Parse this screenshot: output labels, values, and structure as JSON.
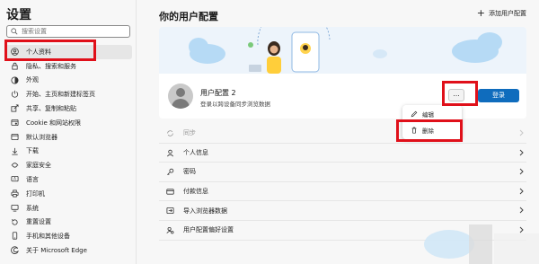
{
  "sidebar": {
    "title": "设置",
    "search_placeholder": "搜索设置",
    "items": [
      {
        "label": "个人资料",
        "icon": "person-icon",
        "active": true
      },
      {
        "label": "隐私、搜索和服务",
        "icon": "lock-icon"
      },
      {
        "label": "外观",
        "icon": "appearance-icon"
      },
      {
        "label": "开始、主页和新建标签页",
        "icon": "power-icon"
      },
      {
        "label": "共享、复制和粘贴",
        "icon": "share-icon"
      },
      {
        "label": "Cookie 和网站权限",
        "icon": "site-permissions-icon"
      },
      {
        "label": "默认浏览器",
        "icon": "browser-icon"
      },
      {
        "label": "下载",
        "icon": "download-icon"
      },
      {
        "label": "家庭安全",
        "icon": "family-icon"
      },
      {
        "label": "语言",
        "icon": "language-icon"
      },
      {
        "label": "打印机",
        "icon": "printer-icon"
      },
      {
        "label": "系统",
        "icon": "system-icon"
      },
      {
        "label": "重置设置",
        "icon": "reset-icon"
      },
      {
        "label": "手机和其他设备",
        "icon": "phone-icon"
      },
      {
        "label": "关于 Microsoft Edge",
        "icon": "edge-icon"
      }
    ]
  },
  "main": {
    "title": "你的用户配置",
    "add_profile": "添加用户配置",
    "profile": {
      "name": "用户配置 2",
      "subtitle": "登录以跨设备同步浏览数据",
      "more_label": "...",
      "signin_label": "登录"
    },
    "menu": {
      "edit": "编辑",
      "delete": "删除"
    },
    "rows": [
      {
        "label": "同步",
        "icon": "sync-icon",
        "dim": true
      },
      {
        "label": "个人信息",
        "icon": "person-card-icon"
      },
      {
        "label": "密码",
        "icon": "key-icon"
      },
      {
        "label": "付款信息",
        "icon": "credit-card-icon"
      },
      {
        "label": "导入浏览器数据",
        "icon": "import-icon"
      },
      {
        "label": "用户配置偏好设置",
        "icon": "profile-settings-icon"
      }
    ]
  },
  "colors": {
    "accent": "#0f6cbd",
    "highlight_box": "#e0101a",
    "banner": "#edf4fb"
  }
}
